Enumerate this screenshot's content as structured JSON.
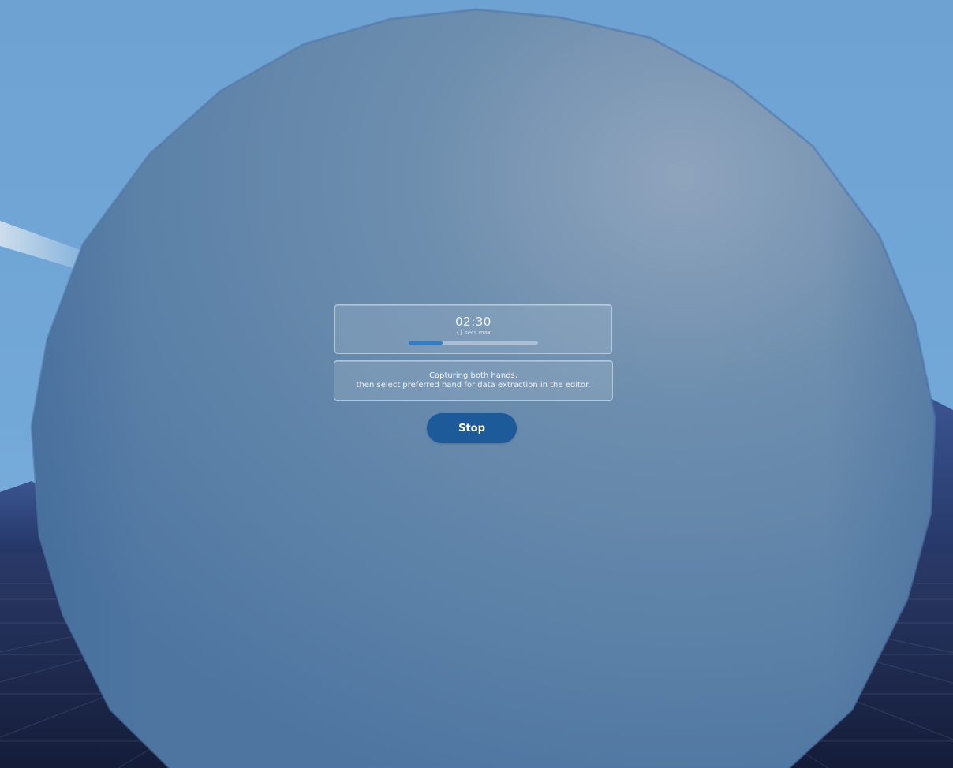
{
  "recorder": {
    "timer": "02:30",
    "timer_caption": "{} secs max",
    "progress_fraction": 0.26,
    "message_line1": "Capturing both hands,",
    "message_line2": "then select preferred hand for data extraction in the editor.",
    "stop_label": "Stop"
  },
  "colors": {
    "sky": "#6ea2d2",
    "sphere": "#5a82a8",
    "progress": "#2a7fd4",
    "button": "#1c5a9a",
    "mountains": "#2a3f72",
    "ground": "#1a2444"
  }
}
